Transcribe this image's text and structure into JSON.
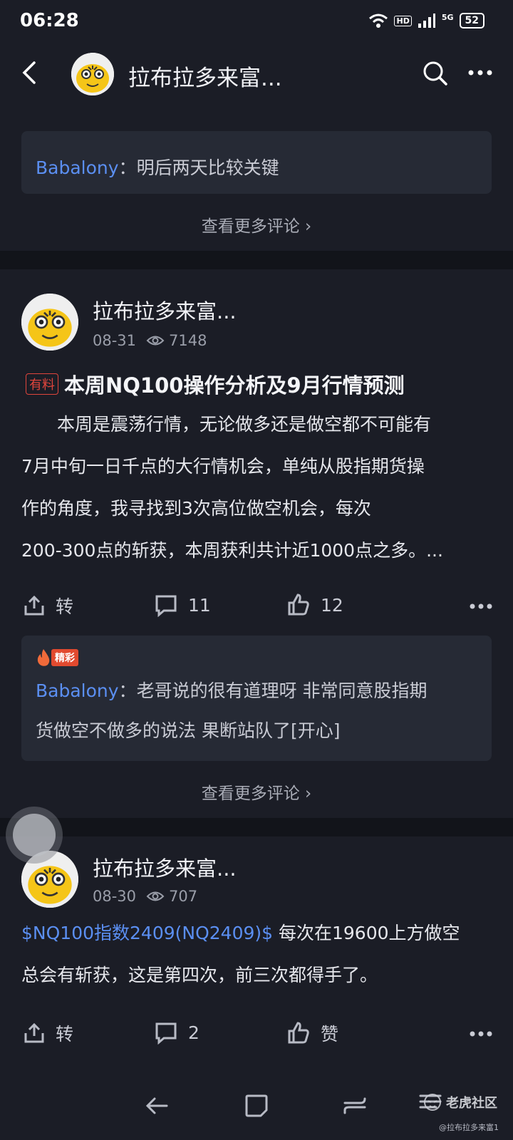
{
  "status_bar": {
    "time": "06:28",
    "battery": "52",
    "network": "5G",
    "hd": "HD"
  },
  "header": {
    "title": "拉布拉多来富..."
  },
  "top_comment": {
    "user": "Babalony",
    "sep": "：",
    "text": "明后两天比较关键"
  },
  "more_comments_label": "查看更多评论",
  "posts": [
    {
      "author": "拉布拉多来富...",
      "date": "08-31",
      "views": "7148",
      "badge": "有料",
      "title": "本周NQ100操作分析及9月行情预测",
      "lines": [
        "　　本周是震荡行情，无论做多还是做空都不可能有",
        "7月中旬一日千点的大行情机会，单纯从股指期货操",
        "作的角度，我寻找到3次高位做空机会，每次",
        "200-300点的斩获，本周获利共计近1000点之多。..."
      ],
      "repost_label": "转",
      "comments_count": "11",
      "likes_count": "12",
      "featured_tag": "精彩",
      "featured_comment": {
        "user": "Babalony",
        "sep": "：",
        "line1": "老哥说的很有道理呀 非常同意股指期",
        "line2": "货做空不做多的说法 果断站队了[开心]"
      }
    },
    {
      "author": "拉布拉多来富...",
      "date": "08-30",
      "views": "707",
      "stock_link": "$NQ100指数2409(NQ2409)$",
      "line1_rest": " 每次在19600上方做空",
      "line2": "总会有斩获，这是第四次，前三次都得手了。",
      "repost_label": "转",
      "comments_count": "2",
      "likes_label": "赞"
    }
  ],
  "watermark": {
    "brand": "老虎社区",
    "handle": "@拉布拉多来富1"
  }
}
